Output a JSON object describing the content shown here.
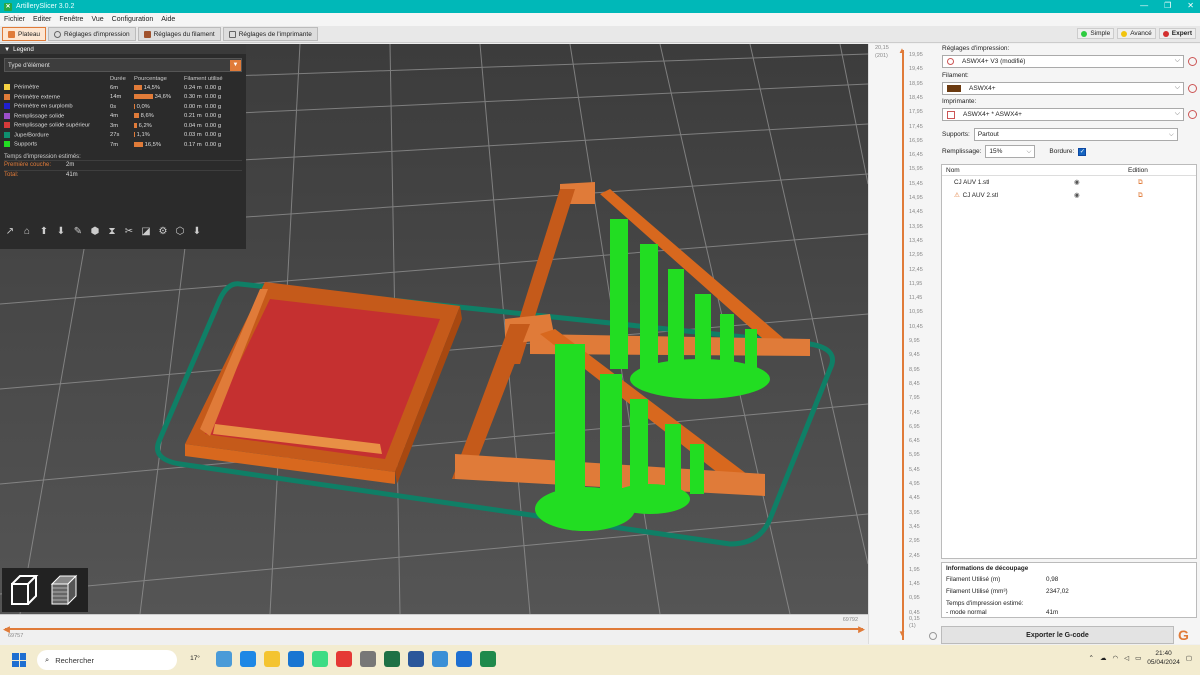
{
  "window": {
    "title": "ArtillerySlicer 3.0.2",
    "controls": [
      "—",
      "❐",
      "✕"
    ]
  },
  "menu": [
    "Fichier",
    "Editer",
    "Fenêtre",
    "Vue",
    "Configuration",
    "Aide"
  ],
  "tabs": [
    {
      "label": "Plateau",
      "color": "#e07b39",
      "active": true
    },
    {
      "label": "Réglages d'impression",
      "color": "#888888",
      "active": false
    },
    {
      "label": "Réglages du filament",
      "color": "#a0522d",
      "active": false
    },
    {
      "label": "Réglages de l'imprimante",
      "color": "#777777",
      "active": false
    }
  ],
  "modes": [
    {
      "label": "Simple",
      "color": "#2ecc40",
      "selected": false
    },
    {
      "label": "Avancé",
      "color": "#f1c40f",
      "selected": false
    },
    {
      "label": "Expert",
      "color": "#d32f2f",
      "selected": true
    }
  ],
  "legend": {
    "title": "Legend",
    "type_select": "Type d'élément",
    "columns": [
      "",
      "Durée",
      "Pourcentage",
      "Filament utilisé"
    ],
    "rows": [
      {
        "name": "Périmètre",
        "color": "#f5d142",
        "time": "6m",
        "pct": "14,5%",
        "pct_value": 14.5,
        "len": "0.24 m",
        "weight": "0.00 g"
      },
      {
        "name": "Périmètre externe",
        "color": "#e07b39",
        "time": "14m",
        "pct": "34,6%",
        "pct_value": 34.6,
        "len": "0.30 m",
        "weight": "0.00 g"
      },
      {
        "name": "Périmètre en surplomb",
        "color": "#2020d0",
        "time": "0s",
        "pct": "0,0%",
        "pct_value": 0.0,
        "len": "0.00 m",
        "weight": "0.00 g"
      },
      {
        "name": "Remplissage solide",
        "color": "#9b4fc9",
        "time": "4m",
        "pct": "8,6%",
        "pct_value": 8.6,
        "len": "0.21 m",
        "weight": "0.00 g"
      },
      {
        "name": "Remplissage solide supérieur",
        "color": "#d63a3a",
        "time": "3m",
        "pct": "6,2%",
        "pct_value": 6.2,
        "len": "0.04 m",
        "weight": "0.00 g"
      },
      {
        "name": "Jupe/Bordure",
        "color": "#0f8f6f",
        "time": "27s",
        "pct": "1,1%",
        "pct_value": 1.1,
        "len": "0.03 m",
        "weight": "0.00 g"
      },
      {
        "name": "Supports",
        "color": "#22dd22",
        "time": "7m",
        "pct": "16,5%",
        "pct_value": 16.5,
        "len": "0.17 m",
        "weight": "0.00 g"
      }
    ],
    "estimated_title": "Temps d'impression estimés:",
    "first_layer_label": "Première couche:",
    "first_layer_value": "2m",
    "total_label": "Total:",
    "total_value": "41m",
    "tool_icons": [
      "travel-icon",
      "wipe-icon",
      "retraction-icon",
      "deretraction-icon",
      "seams-icon",
      "tool-change-icon",
      "color-change-icon",
      "pause-icon",
      "custom-gcode-icon",
      "cog-icon",
      "shells-icon",
      "tool-marker-icon"
    ]
  },
  "ruler": {
    "top_label": "20,15",
    "top_sub": "(201)",
    "ticks": [
      "19,95",
      "19,45",
      "18,95",
      "18,45",
      "17,95",
      "17,45",
      "16,95",
      "16,45",
      "15,95",
      "15,45",
      "14,95",
      "14,45",
      "13,95",
      "13,45",
      "12,95",
      "12,45",
      "11,95",
      "11,45",
      "10,95",
      "10,45",
      "9,95",
      "9,45",
      "8,95",
      "8,45",
      "7,95",
      "7,45",
      "6,95",
      "6,45",
      "5,95",
      "5,45",
      "4,95",
      "4,45",
      "3,95",
      "3,45",
      "2,95",
      "2,45",
      "1,95",
      "1,45",
      "0,95",
      "0,45"
    ],
    "bottom_value": "0,15",
    "bottom_sub": "(1)"
  },
  "hslider": {
    "left_value": "69757",
    "right_value": "69792"
  },
  "right": {
    "print_settings_label": "Réglages d'impression:",
    "print_settings_value": "ASWX4+ V3 (modifié)",
    "filament_label": "Filament:",
    "filament_value": "ASWX4+",
    "filament_color": "#6b3a10",
    "printer_label": "Imprimante:",
    "printer_value": "ASWX4+ * ASWX4+",
    "supports_label": "Supports:",
    "supports_value": "Partout",
    "infill_label": "Remplissage:",
    "infill_value": "15%",
    "brim_label": "Bordure:",
    "brim_checked": true,
    "list_headers": {
      "name": "Nom",
      "edit": "Edition"
    },
    "objects": [
      {
        "name": "CJ AUV 1.stl",
        "warning": false
      },
      {
        "name": "CJ AUV 2.stl",
        "warning": true
      }
    ],
    "slice_info": {
      "title": "Informations de découpage",
      "rows": [
        {
          "label": "Filament Utilisé (m)",
          "value": "0,98"
        },
        {
          "label": "Filament Utilisé (mm³)",
          "value": "2347,02"
        },
        {
          "label": "Temps d'impression estimé:",
          "value": ""
        },
        {
          "label": "- mode normal",
          "value": "41m"
        }
      ]
    },
    "export_label": "Exporter le G-code"
  },
  "taskbar": {
    "search_placeholder": "Rechercher",
    "weather_temp": "17°",
    "time": "21:40",
    "date": "05/04/2024",
    "apps": [
      "widgets-icon",
      "edge-icon",
      "file-explorer-icon",
      "mail-icon",
      "android-studio-icon",
      "chrome-icon",
      "settings-icon",
      "excel-icon",
      "word-icon",
      "artillery-slicer-icon",
      "cura-icon",
      "artillery-slicer-active-icon"
    ]
  }
}
